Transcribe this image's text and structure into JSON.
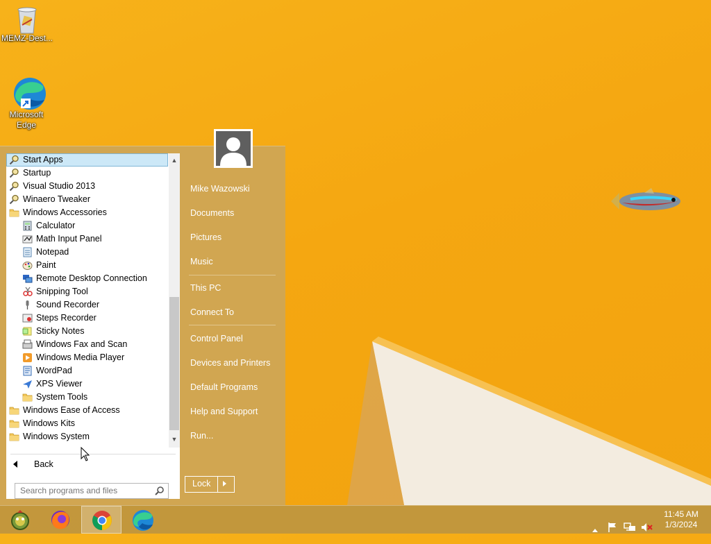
{
  "desktop": {
    "icons": [
      {
        "label": "MEMZ-Dest...",
        "icon": "recycle-bin-icon"
      },
      {
        "label": "Microsoft Edge",
        "icon": "edge-icon"
      }
    ]
  },
  "start_menu": {
    "programs": [
      {
        "label": "Start Apps",
        "level": 0,
        "icon": "search-icon",
        "selected": true
      },
      {
        "label": "Startup",
        "level": 0,
        "icon": "search-icon"
      },
      {
        "label": "Visual Studio 2013",
        "level": 0,
        "icon": "search-icon"
      },
      {
        "label": "Winaero Tweaker",
        "level": 0,
        "icon": "search-icon"
      },
      {
        "label": "Windows Accessories",
        "level": 0,
        "icon": "folder-icon"
      },
      {
        "label": "Calculator",
        "level": 1,
        "icon": "calculator-icon"
      },
      {
        "label": "Math Input Panel",
        "level": 1,
        "icon": "math-input-icon"
      },
      {
        "label": "Notepad",
        "level": 1,
        "icon": "notepad-icon"
      },
      {
        "label": "Paint",
        "level": 1,
        "icon": "paint-icon"
      },
      {
        "label": "Remote Desktop Connection",
        "level": 1,
        "icon": "remote-desktop-icon"
      },
      {
        "label": "Snipping Tool",
        "level": 1,
        "icon": "snipping-tool-icon"
      },
      {
        "label": "Sound Recorder",
        "level": 1,
        "icon": "microphone-icon"
      },
      {
        "label": "Steps Recorder",
        "level": 1,
        "icon": "steps-recorder-icon"
      },
      {
        "label": "Sticky Notes",
        "level": 1,
        "icon": "sticky-notes-icon"
      },
      {
        "label": "Windows Fax and Scan",
        "level": 1,
        "icon": "fax-icon"
      },
      {
        "label": "Windows Media Player",
        "level": 1,
        "icon": "media-player-icon"
      },
      {
        "label": "WordPad",
        "level": 1,
        "icon": "wordpad-icon"
      },
      {
        "label": "XPS Viewer",
        "level": 1,
        "icon": "xps-viewer-icon"
      },
      {
        "label": "System Tools",
        "level": 1,
        "icon": "folder-icon"
      },
      {
        "label": "Windows Ease of Access",
        "level": 0,
        "icon": "folder-icon"
      },
      {
        "label": "Windows Kits",
        "level": 0,
        "icon": "folder-icon"
      },
      {
        "label": "Windows System",
        "level": 0,
        "icon": "folder-icon"
      }
    ],
    "back_label": "Back",
    "search_placeholder": "Search programs and files",
    "user_name": "Mike Wazowski",
    "links": [
      {
        "label": "Documents"
      },
      {
        "label": "Pictures"
      },
      {
        "label": "Music"
      },
      {
        "label": "This PC"
      },
      {
        "label": "Connect To"
      },
      {
        "label": "Control Panel"
      },
      {
        "label": "Devices and Printers"
      },
      {
        "label": "Default Programs"
      },
      {
        "label": "Help and Support"
      },
      {
        "label": "Run..."
      }
    ],
    "lock_label": "Lock"
  },
  "taskbar": {
    "apps": [
      {
        "icon": "start-orb-icon",
        "active": false
      },
      {
        "icon": "firefox-icon",
        "active": false
      },
      {
        "icon": "chrome-icon",
        "active": true
      },
      {
        "icon": "edge-icon",
        "active": false
      }
    ],
    "tray_icons": [
      "show-hidden-icons-chevron-icon",
      "action-center-flag-icon",
      "network-icon",
      "volume-muted-icon"
    ],
    "time": "11:45 AM",
    "date": "1/3/2024"
  },
  "colors": {
    "wallpaper": "#f5a711",
    "menu_tint": "#cda656",
    "selection": "#cce8f7"
  }
}
